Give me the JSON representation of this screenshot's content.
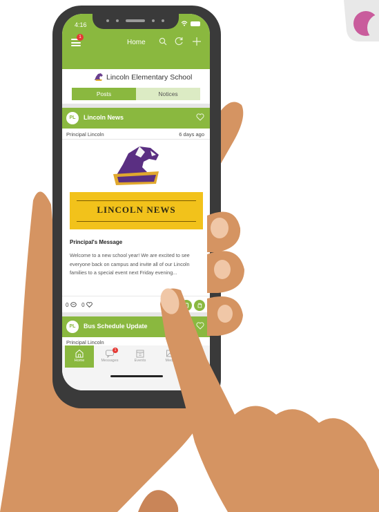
{
  "status": {
    "time": "4:16"
  },
  "header": {
    "title": "Home",
    "menu_badge": "1"
  },
  "school": {
    "name": "Lincoln Elementary School"
  },
  "tabs": [
    {
      "label": "Posts"
    },
    {
      "label": "Notices"
    }
  ],
  "post": {
    "avatar": "PL",
    "title": "Lincoln News",
    "author": "Principal Lincoln",
    "time": "6 days ago",
    "banner_text": "LINCOLN NEWS",
    "subtitle": "Principal's Message",
    "body": "Welcome to a new school year! We are excited to see everyone back on campus and invite all of our Lincoln families to a special event next Friday evening...",
    "comments": "0",
    "likes": "0"
  },
  "post2": {
    "avatar": "PL",
    "title": "Bus Schedule Update",
    "author": "Principal Lincoln"
  },
  "nav": {
    "items": [
      {
        "label": "Home"
      },
      {
        "label": "Messages"
      },
      {
        "label": "Events"
      },
      {
        "label": "Media"
      }
    ],
    "messages_badge": "1"
  },
  "colors": {
    "brand_green": "#8ab83f",
    "skin": "#d59462",
    "phone_body": "#3a3a3a",
    "banner_gold": "#f2c21b",
    "badge_red": "#e53935"
  }
}
